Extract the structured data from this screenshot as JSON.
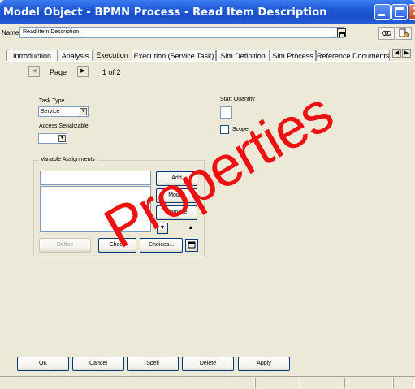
{
  "window": {
    "title": "Model Object - BPMN Process - Read Item Description",
    "close_glyph": "✕"
  },
  "name_row": {
    "label": "Name",
    "value": "Read Item Description"
  },
  "tabs": [
    {
      "label": "Introduction"
    },
    {
      "label": "Analysis"
    },
    {
      "label": "Execution",
      "active": true
    },
    {
      "label": "Execution (Service Task)"
    },
    {
      "label": "Sim Definition"
    },
    {
      "label": "Sim Process"
    },
    {
      "label": "Reference Documents"
    }
  ],
  "pager": {
    "label": "Page",
    "indicator": "1 of 2"
  },
  "execution": {
    "task_type_label": "Task Type",
    "task_type_value": "Service",
    "access_serializable_label": "Access Serializable",
    "access_serializable_value": "",
    "start_quantity_label": "Start Quantity",
    "scope_label": "Scope"
  },
  "variable_assignments": {
    "title": "Variable Assignments",
    "add": "Add",
    "modify": "Modify",
    "remove": "Remove",
    "define": "Define",
    "check": "Check",
    "choices": "Choices..."
  },
  "footer": {
    "ok": "OK",
    "cancel": "Cancel",
    "spell": "Spell",
    "delete": "Delete",
    "apply": "Apply"
  },
  "watermark": "Properties"
}
